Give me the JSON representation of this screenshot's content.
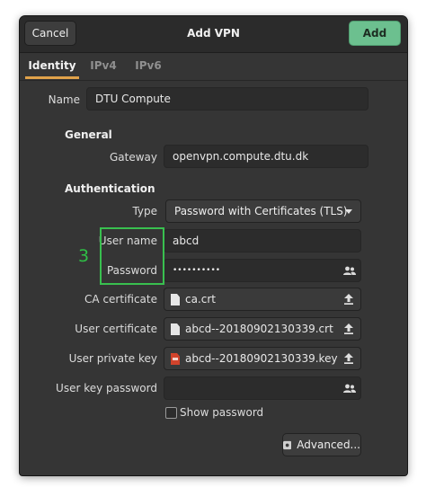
{
  "dialog": {
    "title": "Add VPN",
    "cancel_label": "Cancel",
    "add_label": "Add"
  },
  "tabs": [
    {
      "label": "Identity",
      "active": true
    },
    {
      "label": "IPv4",
      "active": false
    },
    {
      "label": "IPv6",
      "active": false
    }
  ],
  "identity": {
    "name_label": "Name",
    "name_value": "DTU Compute"
  },
  "general": {
    "heading": "General",
    "gateway_label": "Gateway",
    "gateway_value": "openvpn.compute.dtu.dk"
  },
  "authentication": {
    "heading": "Authentication",
    "type_label": "Type",
    "type_value": "Password with Certificates (TLS)",
    "username_label": "User name",
    "username_value": "abcd",
    "password_label": "Password",
    "password_value": "••••••••••",
    "ca_cert_label": "CA certificate",
    "ca_cert_file": "ca.crt",
    "user_cert_label": "User certificate",
    "user_cert_file": "abcd--20180902130339.crt",
    "private_key_label": "User private key",
    "private_key_file": "abcd--20180902130339.key",
    "key_password_label": "User key password",
    "key_password_value": "",
    "show_password_label": "Show password",
    "show_password_checked": false,
    "advanced_label": "Advanced..."
  },
  "annotation": {
    "step_number": "3",
    "color": "#39c04f"
  },
  "colors": {
    "accent_tab": "#e0a24a",
    "add_button": "#6cc08f",
    "window_bg": "#353535"
  },
  "icons": {
    "password_menu": "people-icon",
    "file_browse": "upload-arrow-icon",
    "type_dropdown": "triangle-down-icon"
  }
}
